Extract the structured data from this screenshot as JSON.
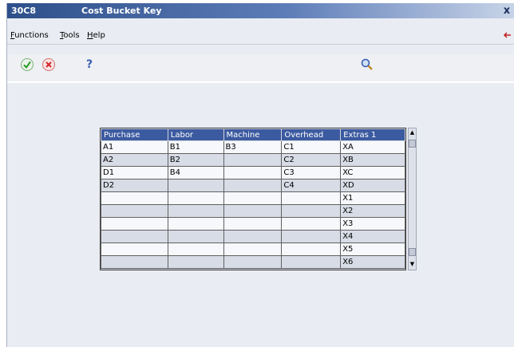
{
  "window": {
    "code": "30C8",
    "title": "Cost Bucket Key",
    "close_glyph": "x"
  },
  "menubar": {
    "items": [
      "Functions",
      "Tools",
      "Help"
    ]
  },
  "toolbar": {
    "ok_icon": "checkmark-icon",
    "cancel_icon": "cancel-icon",
    "help_label": "?",
    "search_icon": "magnifier-icon"
  },
  "grid": {
    "columns": [
      "Purchase",
      "Labor",
      "Machine",
      "Overhead",
      "Extras 1"
    ],
    "rows": [
      [
        "A1",
        "B1",
        "B3",
        "C1",
        "XA"
      ],
      [
        "A2",
        "B2",
        "",
        "C2",
        "XB"
      ],
      [
        "D1",
        "B4",
        "",
        "C3",
        "XC"
      ],
      [
        "D2",
        "",
        "",
        "C4",
        "XD"
      ],
      [
        "",
        "",
        "",
        "",
        "X1"
      ],
      [
        "",
        "",
        "",
        "",
        "X2"
      ],
      [
        "",
        "",
        "",
        "",
        "X3"
      ],
      [
        "",
        "",
        "",
        "",
        "X4"
      ],
      [
        "",
        "",
        "",
        "",
        "X5"
      ],
      [
        "",
        "",
        "",
        "",
        "X6"
      ]
    ]
  },
  "colors": {
    "title_bar": "#2d4f8a",
    "grid_header": "#3c5aa0",
    "ok_green": "#2a9a2a",
    "cancel_red": "#d02828"
  }
}
